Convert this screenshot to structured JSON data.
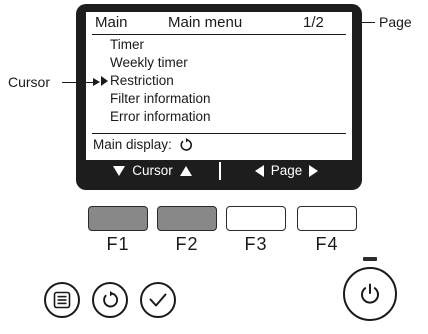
{
  "screen": {
    "header_left": "Main",
    "header_center": "Main menu",
    "page_indicator": "1/2",
    "menu_items": [
      {
        "label": "Timer"
      },
      {
        "label": "Weekly timer"
      },
      {
        "label": "Restriction"
      },
      {
        "label": "Filter information"
      },
      {
        "label": "Error information"
      }
    ],
    "selected_index": 2,
    "main_display_label": "Main display:",
    "main_display_icon": "return-icon",
    "function_bar": {
      "cursor_label": "Cursor",
      "page_label": "Page"
    }
  },
  "callouts": {
    "page": "Page",
    "cursor": "Cursor"
  },
  "function_keys": [
    {
      "label": "F1",
      "pressed": true
    },
    {
      "label": "F2",
      "pressed": true
    },
    {
      "label": "F3",
      "pressed": false
    },
    {
      "label": "F4",
      "pressed": false
    }
  ],
  "buttons": {
    "menu_icon": "menu-icon",
    "return_icon": "return-icon",
    "select_icon": "checkmark-icon",
    "power_icon": "power-icon"
  },
  "colors": {
    "pressed_key": "#888888",
    "lcd_frame": "#1d1d1d"
  }
}
